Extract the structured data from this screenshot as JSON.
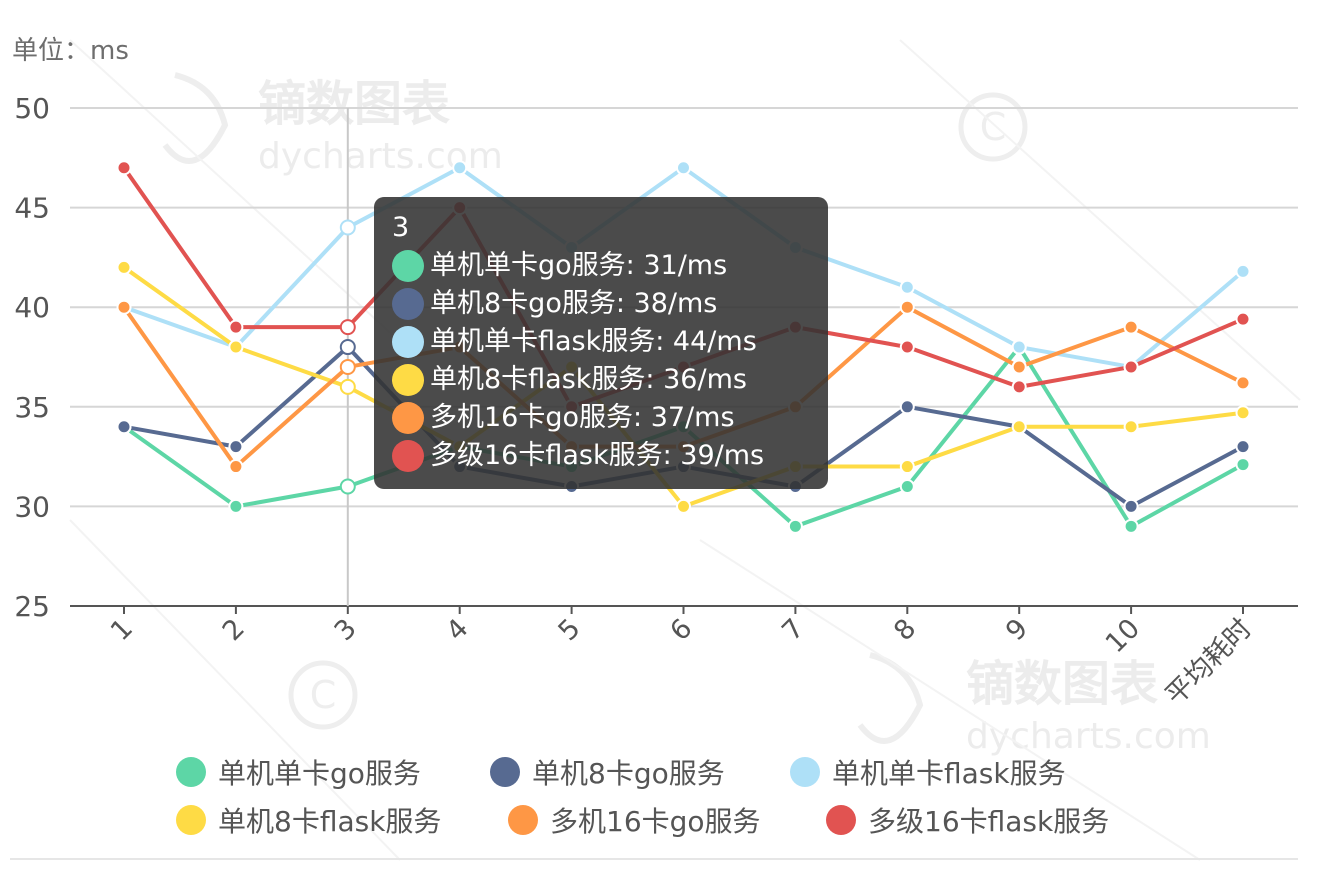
{
  "unit_label": "单位：ms",
  "watermark": {
    "text_cn": "镝数图表",
    "text_en": "dycharts.com"
  },
  "chart_data": {
    "type": "line",
    "categories": [
      "1",
      "2",
      "3",
      "4",
      "5",
      "6",
      "7",
      "8",
      "9",
      "10",
      "平均耗时"
    ],
    "ylim": [
      25,
      50
    ],
    "yticks": [
      25,
      30,
      35,
      40,
      45,
      50
    ],
    "grid": true,
    "legend_position": "bottom",
    "series": [
      {
        "name": "单机单卡go服务",
        "color": "#5dd6a6",
        "values": [
          34,
          30,
          31,
          33,
          32,
          34,
          29,
          31,
          38,
          29,
          32.1
        ]
      },
      {
        "name": "单机8卡go服务",
        "color": "#576a91",
        "values": [
          34,
          33,
          38,
          32,
          31,
          32,
          31,
          35,
          34,
          30,
          33
        ]
      },
      {
        "name": "单机单卡flask服务",
        "color": "#aee0f7",
        "values": [
          40,
          38,
          44,
          47,
          43,
          47,
          43,
          41,
          38,
          37,
          41.8
        ]
      },
      {
        "name": "单机8卡flask服务",
        "color": "#fedb45",
        "values": [
          42,
          38,
          36,
          33,
          37,
          30,
          32,
          32,
          34,
          34,
          34.7
        ]
      },
      {
        "name": "多机16卡go服务",
        "color": "#fe9745",
        "values": [
          40,
          32,
          37,
          38,
          33,
          33,
          35,
          40,
          37,
          39,
          36.2
        ]
      },
      {
        "name": "多级16卡flask服务",
        "color": "#e15351",
        "values": [
          47,
          39,
          39,
          45,
          35,
          37,
          39,
          38,
          36,
          37,
          39.4
        ]
      }
    ]
  },
  "tooltip": {
    "title": "3",
    "rows": [
      {
        "text": "单机单卡go服务: 31/ms",
        "color": "#5dd6a6"
      },
      {
        "text": "单机8卡go服务: 38/ms",
        "color": "#576a91"
      },
      {
        "text": "单机单卡flask服务: 44/ms",
        "color": "#aee0f7"
      },
      {
        "text": "单机8卡flask服务: 36/ms",
        "color": "#fedb45"
      },
      {
        "text": "多机16卡go服务: 37/ms",
        "color": "#fe9745"
      },
      {
        "text": "多级16卡flask服务: 39/ms",
        "color": "#e15351"
      }
    ]
  },
  "legend": [
    {
      "label": "单机单卡go服务",
      "color": "#5dd6a6"
    },
    {
      "label": "单机8卡go服务",
      "color": "#576a91"
    },
    {
      "label": "单机单卡flask服务",
      "color": "#aee0f7"
    },
    {
      "label": "单机8卡flask服务",
      "color": "#fedb45"
    },
    {
      "label": "多机16卡go服务",
      "color": "#fe9745"
    },
    {
      "label": "多级16卡flask服务",
      "color": "#e15351"
    }
  ]
}
